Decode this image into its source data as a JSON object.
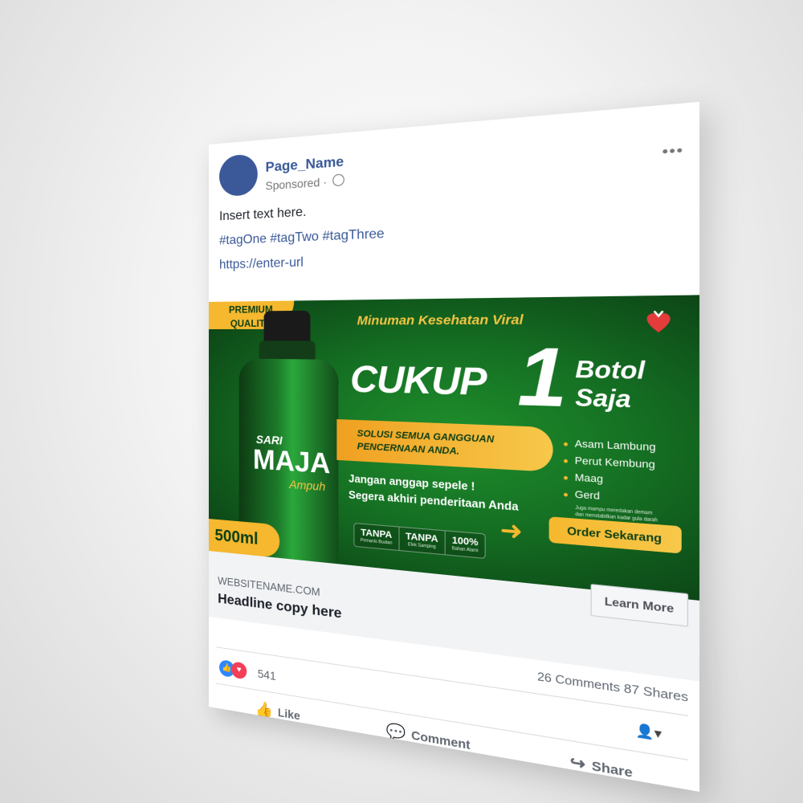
{
  "post": {
    "page_name": "Page_Name",
    "sponsored": "Sponsored",
    "sponsored_sep": "·",
    "more_icon": "more-horizontal-icon",
    "body_text": "Insert text here.",
    "hashtags": "#tagOne #tagTwo #tagThree",
    "url": "https://enter-url"
  },
  "ad": {
    "premium_line1": "PREMIUM",
    "premium_line2": "QUALITY",
    "bottle_sari": "SARI",
    "bottle_maja": "MAJA",
    "bottle_ampuh": "Ampuh",
    "size": "500ml",
    "subtitle": "Minuman Kesehatan Viral",
    "cukup": "CUKUP",
    "one": "1",
    "botol": "Botol",
    "saja": "Saja",
    "solution_line1": "SOLUSI SEMUA GANGGUAN",
    "solution_line2": "PENCERNAAN ANDA.",
    "tagline1": "Jangan anggap sepele !",
    "tagline2": "Segera akhiri penderitaan Anda",
    "badges": [
      {
        "title": "TANPA",
        "sub": "Pemanis Buatan"
      },
      {
        "title": "TANPA",
        "sub": "Efek Samping"
      },
      {
        "title": "100%",
        "sub": "Bahan Alami"
      }
    ],
    "benefits": [
      "Asam Lambung",
      "Perut Kembung",
      "Maag",
      "Gerd"
    ],
    "fine_print_1": "Juga mampu meredakan demam",
    "fine_print_2": "dan menstabilkan kadar gula darah",
    "cta": "Order Sekarang",
    "accent_gold": "#f5b82e",
    "accent_green": "#157023"
  },
  "link": {
    "website": "WEBSITENAME.COM",
    "headline": "Headline copy here",
    "button": "Learn More"
  },
  "stats": {
    "comments": "26 Comments",
    "shares": "87 Shares",
    "reaction_count": "541"
  },
  "actions": {
    "like": "Like",
    "comment": "Comment",
    "share": "Share"
  }
}
